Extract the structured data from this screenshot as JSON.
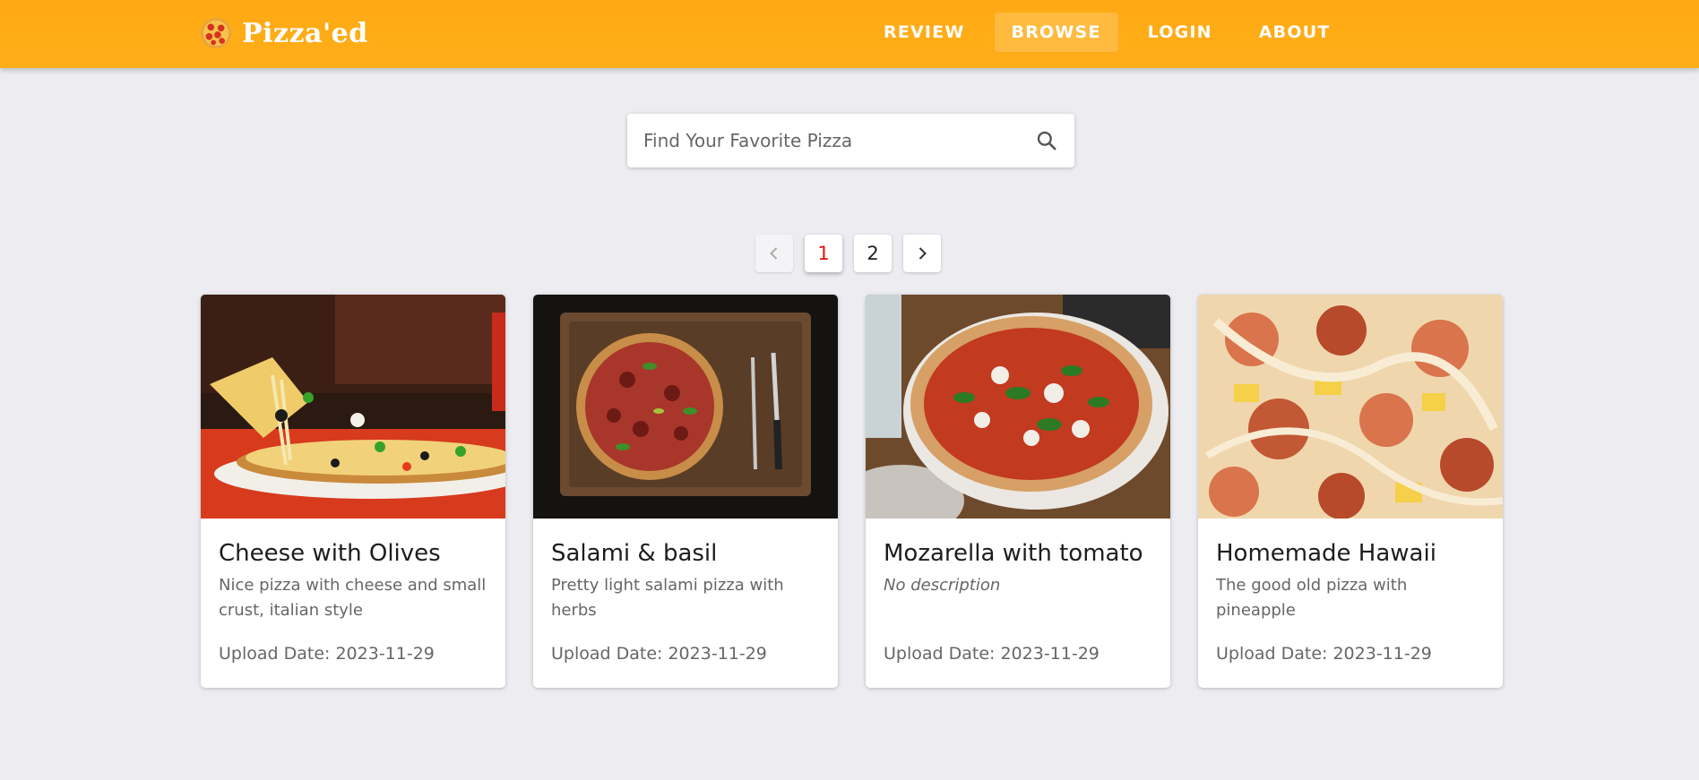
{
  "app": {
    "name": "Pizza'ed",
    "logo_icon": "pizza-icon",
    "accent": "#ffab16"
  },
  "nav": {
    "items": [
      {
        "label": "REVIEW",
        "active": false
      },
      {
        "label": "BROWSE",
        "active": true
      },
      {
        "label": "LOGIN",
        "active": false
      },
      {
        "label": "ABOUT",
        "active": false
      }
    ]
  },
  "search": {
    "placeholder": "Find Your Favorite Pizza",
    "value": "",
    "icon": "search-icon"
  },
  "pagination": {
    "prev_icon": "chevron-left-icon",
    "next_icon": "chevron-right-icon",
    "pages": [
      "1",
      "2"
    ],
    "current": "1"
  },
  "cards": [
    {
      "title": "Cheese with Olives",
      "description": "Nice pizza with cheese and small crust, italian style",
      "date_text": "Upload Date: 2023-11-29",
      "image": "pizza-photo"
    },
    {
      "title": "Salami & basil",
      "description": "Pretty light salami pizza with herbs",
      "date_text": "Upload Date: 2023-11-29",
      "image": "pizza-photo"
    },
    {
      "title": "Mozarella with tomato",
      "description": "No description",
      "date_text": "Upload Date: 2023-11-29",
      "image": "pizza-photo"
    },
    {
      "title": "Homemade Hawaii",
      "description": "The good old pizza with pineapple",
      "date_text": "Upload Date: 2023-11-29",
      "image": "pizza-photo"
    }
  ]
}
